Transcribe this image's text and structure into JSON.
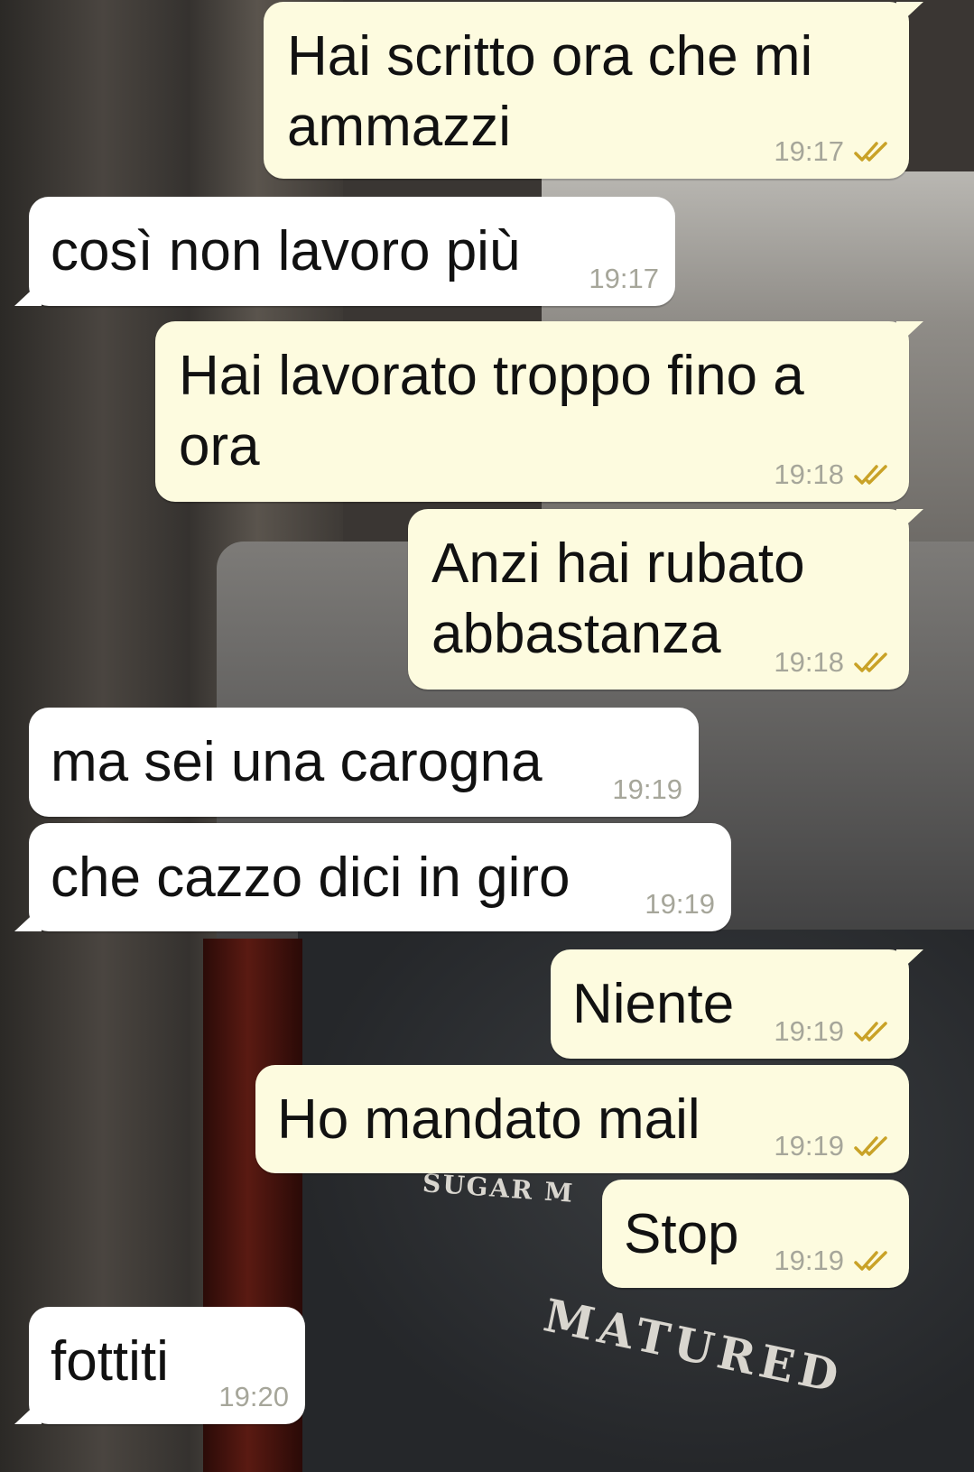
{
  "messages": [
    {
      "direction": "out",
      "text": "Hai scritto ora che mi\nammazzi",
      "time": "19:17",
      "read": true
    },
    {
      "direction": "in",
      "text": "così non lavoro più",
      "time": "19:17"
    },
    {
      "direction": "out",
      "text": "Hai lavorato troppo fino a\nora",
      "time": "19:18",
      "read": true
    },
    {
      "direction": "out",
      "text": "Anzi hai rubato\nabbastanza",
      "time": "19:18",
      "read": true
    },
    {
      "direction": "in",
      "text": "ma sei una carogna",
      "time": "19:19"
    },
    {
      "direction": "in",
      "text": "che cazzo dici in giro",
      "time": "19:19"
    },
    {
      "direction": "out",
      "text": "Niente",
      "time": "19:19",
      "read": true
    },
    {
      "direction": "out",
      "text": "Ho mandato mail",
      "time": "19:19",
      "read": true
    },
    {
      "direction": "out",
      "text": "Stop",
      "time": "19:19",
      "read": true
    },
    {
      "direction": "in",
      "text": "fottiti",
      "time": "19:20"
    }
  ],
  "wallpaper": {
    "label_text_1": "SUGAR M",
    "label_text_2": "MATURED"
  },
  "colors": {
    "outgoing_bubble": "#fdfbdf",
    "incoming_bubble": "#ffffff",
    "timestamp": "#a6a69a",
    "read_ticks": "#c9a227"
  }
}
